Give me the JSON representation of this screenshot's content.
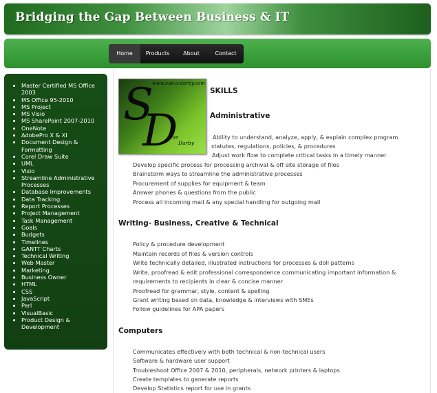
{
  "header": {
    "title": "Bridging the Gap Between Business & IT"
  },
  "nav": {
    "items": [
      {
        "label": "Home"
      },
      {
        "label": "Products"
      },
      {
        "label": "About"
      },
      {
        "label": "Contact"
      }
    ]
  },
  "sidebar": {
    "items": [
      [
        "Master Certified MS Office",
        "2003"
      ],
      [
        "MS Office 95-2010"
      ],
      [
        "MS Project"
      ],
      [
        "MS Visio"
      ],
      [
        "MS SharePoint 2007-2010"
      ],
      [
        "OneNote"
      ],
      [
        "AdobePro X & XI"
      ],
      [
        "Document Design &",
        "Formatting"
      ],
      [
        "Corel Draw Suite"
      ],
      [
        "UML"
      ],
      [
        "Visio"
      ],
      [
        "Streamline Administrative",
        "Processes"
      ],
      [
        "Database Improvements"
      ],
      [
        "Data Tracking"
      ],
      [
        "Report Processes"
      ],
      [
        "Project Management"
      ],
      [
        "Task Management"
      ],
      [
        "Goals"
      ],
      [
        "Budgets"
      ],
      [
        "Timelines"
      ],
      [
        "GANTT Charts"
      ],
      [
        "Technical Writing"
      ],
      [
        "Web Master"
      ],
      [
        "Marketing"
      ],
      [
        "Business Owner"
      ],
      [
        "HTML"
      ],
      [
        "CSS"
      ],
      [
        "JavaScript"
      ],
      [
        "Perl"
      ],
      [
        "VisualBasic"
      ],
      [
        "Product Design &",
        "Development"
      ]
    ]
  },
  "logo": {
    "url": "www.sue-a-darby.com",
    "letter1": "S",
    "letter2": "D",
    "first": "Sue",
    "last": "Darby"
  },
  "skills_heading": "SKILLS",
  "admin": {
    "heading": "Administrative",
    "lines": [
      "Ability to understand, analyze, apply, & explain complex program",
      "statutes, regulations, policies, & procedures",
      "Adjust work flow to complete critical tasks in a timely manner",
      "Develop specific process for processing archival & off site storage of files",
      "Brainstorm ways to streamline the administrative processes",
      "Procurement of supplies for equipment & team",
      "Answer phones & questions from the public",
      "Process all incoming mail & any special handling for outgoing mail"
    ]
  },
  "writing": {
    "heading": "Writing- Business, Creative & Technical",
    "lines": [
      "Policy & procedure development",
      "Maintain records of files & version controls",
      "Write technically detailed, illustrated instructions for processes & doll patterns",
      "Write, proofread & edit professional correspondence communicating important information &",
      "requirements to recipients in clear & concise manner",
      "Proofread for grammar, style, content & spelling",
      "Grant writing based on data, knowledge & interviews with SMEs",
      "Follow guidelines for APA papers"
    ]
  },
  "computers": {
    "heading": "Computers",
    "lines": [
      "Communicates effectively with both technical & non-technical users",
      "Software & hardware user support",
      "Troubleshoot Office 2007 & 2010, peripherals, network printers & laptops",
      "Create templates to generate reports",
      "Develop Statistics report for use in grants"
    ]
  }
}
